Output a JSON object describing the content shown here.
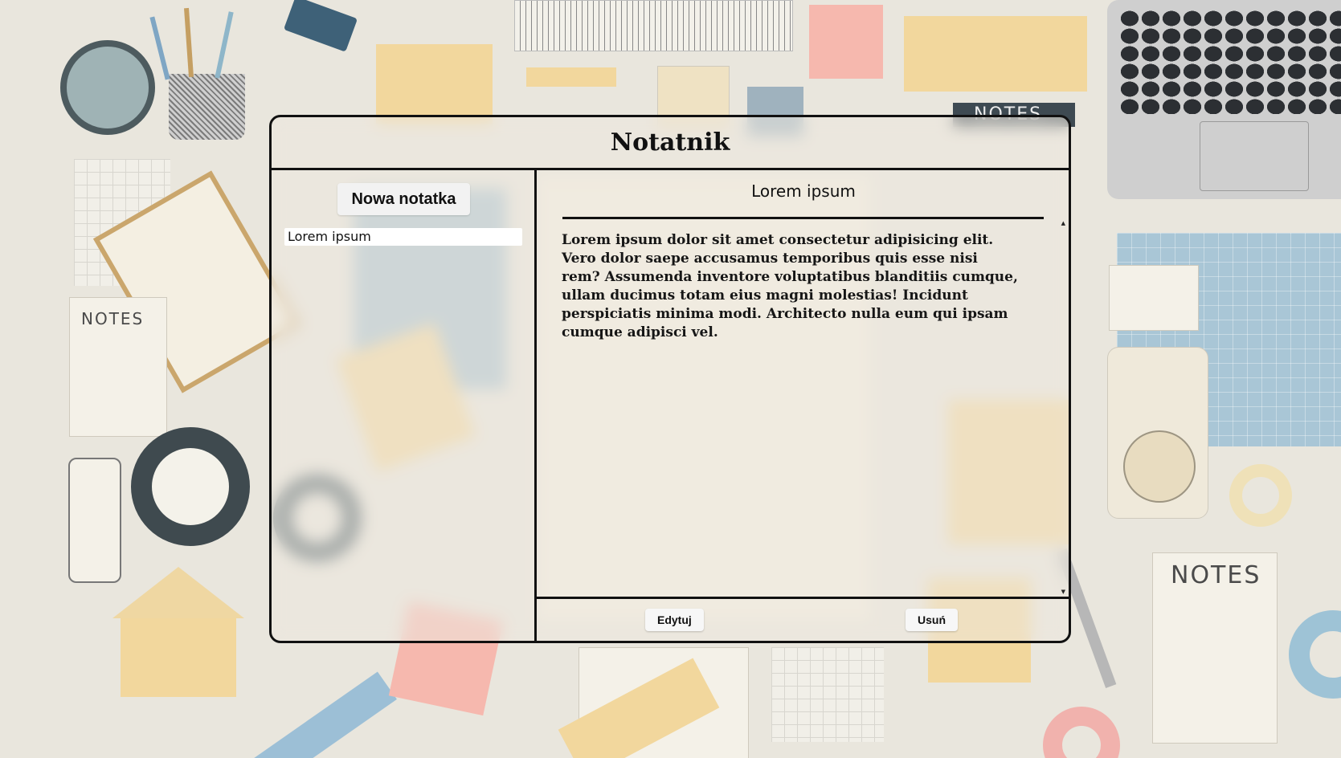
{
  "app": {
    "title": "Notatnik"
  },
  "sidebar": {
    "new_note_label": "Nowa notatka",
    "notes": [
      {
        "title": "Lorem ipsum"
      }
    ]
  },
  "note": {
    "title": "Lorem ipsum",
    "body": "Lorem ipsum dolor sit amet consectetur adipisicing elit. Vero dolor saepe accusamus temporibus quis esse nisi rem? Assumenda inventore voluptatibus blanditiis cumque, ullam ducimus totam eius magni molestias! Incidunt perspiciatis minima modi. Architecto nulla eum qui ipsam cumque adipisci vel."
  },
  "actions": {
    "edit_label": "Edytuj",
    "delete_label": "Usuń"
  },
  "background": {
    "notes_labels": [
      "NOTES",
      "NOTES",
      "NOTES"
    ]
  },
  "colors": {
    "border": "#111111",
    "button_bg": "#f2f2f2",
    "list_item_bg": "#ffffff"
  },
  "icons": {
    "scroll_up": "scroll-up-arrow-icon",
    "scroll_down": "scroll-down-arrow-icon"
  }
}
